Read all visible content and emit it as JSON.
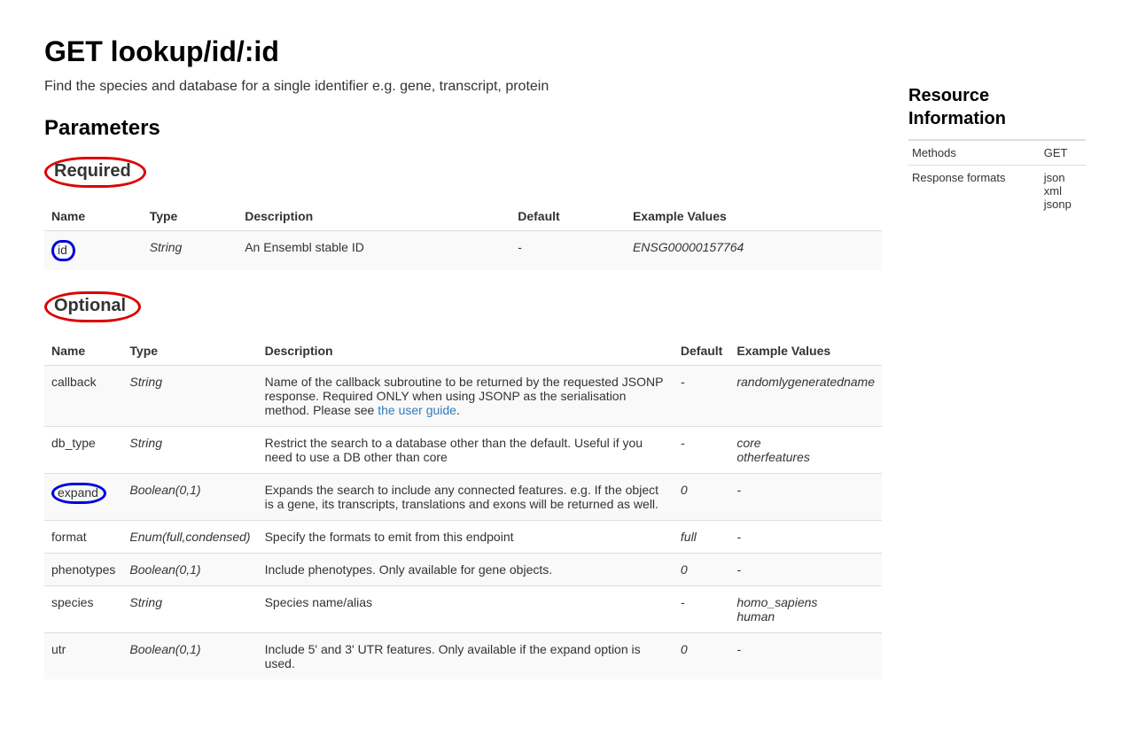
{
  "title": "GET lookup/id/:id",
  "subtitle": "Find the species and database for a single identifier e.g. gene, transcript, protein",
  "sections_heading": "Parameters",
  "required": {
    "heading": "Required",
    "columns": [
      "Name",
      "Type",
      "Description",
      "Default",
      "Example Values"
    ],
    "rows": [
      {
        "name": "id",
        "type": "String",
        "description": "An Ensembl stable ID",
        "default": "-",
        "example": "ENSG00000157764",
        "name_circled": true
      }
    ]
  },
  "optional": {
    "heading": "Optional",
    "columns": [
      "Name",
      "Type",
      "Description",
      "Default",
      "Example Values"
    ],
    "rows": [
      {
        "name": "callback",
        "type": "String",
        "description_pre": "Name of the callback subroutine to be returned by the requested JSONP response. Required ONLY when using JSONP as the serialisation method. Please see ",
        "description_link": "the user guide",
        "description_post": ".",
        "default": "-",
        "example": "randomlygeneratedname"
      },
      {
        "name": "db_type",
        "type": "String",
        "description": "Restrict the search to a database other than the default. Useful if you need to use a DB other than core",
        "default": "-",
        "example": "core\notherfeatures"
      },
      {
        "name": "expand",
        "type": "Boolean(0,1)",
        "description": "Expands the search to include any connected features. e.g. If the object is a gene, its transcripts, translations and exons will be returned as well.",
        "default": "0",
        "example": "-",
        "name_circled": true
      },
      {
        "name": "format",
        "type": "Enum(full,condensed)",
        "description": "Specify the formats to emit from this endpoint",
        "default": "full",
        "example": "-"
      },
      {
        "name": "phenotypes",
        "type": "Boolean(0,1)",
        "description": "Include phenotypes. Only available for gene objects.",
        "default": "0",
        "example": "-"
      },
      {
        "name": "species",
        "type": "String",
        "description": "Species name/alias",
        "default": "-",
        "example": "homo_sapiens\nhuman"
      },
      {
        "name": "utr",
        "type": "Boolean(0,1)",
        "description": "Include 5' and 3' UTR features. Only available if the expand option is used.",
        "default": "0",
        "example": "-"
      }
    ]
  },
  "sidebar": {
    "heading": "Resource Information",
    "rows": [
      {
        "label": "Methods",
        "value": "GET"
      },
      {
        "label": "Response formats",
        "value": "json\nxml\njsonp"
      }
    ]
  }
}
